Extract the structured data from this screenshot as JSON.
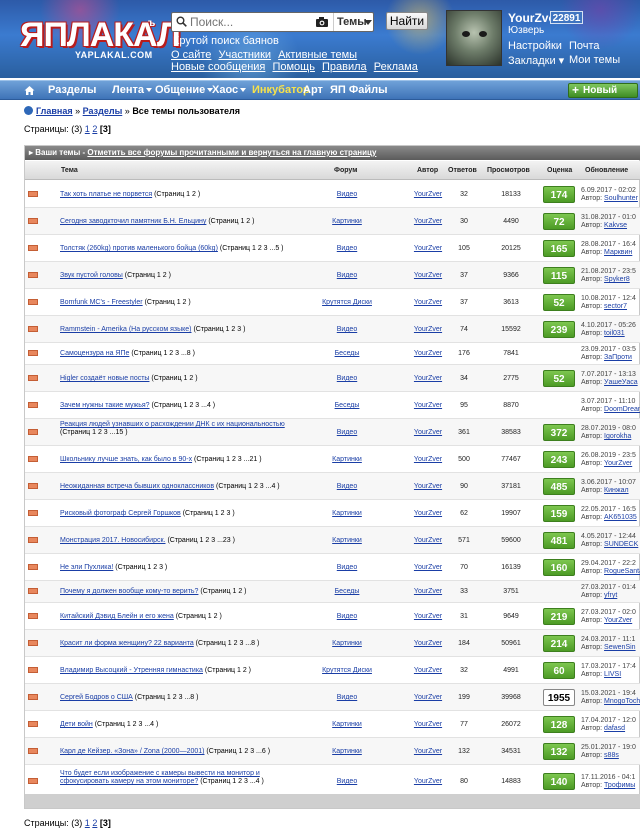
{
  "header": {
    "logo_text": "ЯПЛАКАЛ",
    "logo_sup": "ъ",
    "logo_sub": "YAPLAKAL.COM",
    "search_placeholder": "Поиск...",
    "themes_label": "Темы",
    "find_label": "Найти",
    "tagline": "Крутой поиск баянов",
    "links_row1": [
      "О сайте",
      "Участники",
      "Активные темы"
    ],
    "links_row2": [
      "Новые сообщения",
      "Помощь",
      "Правила",
      "Реклама"
    ],
    "user": {
      "name": "YourZver",
      "rating": "22891",
      "rank": "Юзверь",
      "settings": "Настройки",
      "mail": "Почта",
      "bookmarks": "Закладки",
      "my_topics": "Мои темы"
    }
  },
  "nav": {
    "items": [
      "Разделы",
      "Лента",
      "Общение",
      "Хаос",
      "Инкубатор",
      "Арт",
      "ЯП Файлы"
    ],
    "new_post": "Новый пост"
  },
  "breadcrumb": {
    "home": "Главная",
    "sep1": "»",
    "sections": "Разделы",
    "sep2": "»",
    "current": "Все темы пользователя"
  },
  "pager": {
    "label": "Страницы:",
    "count": "(3)",
    "p1": "1",
    "p2": "2",
    "current": "[3]"
  },
  "topics": {
    "head_label": "Ваши темы",
    "head_dash": " - ",
    "head_link": "Отметить все форумы прочитанными и вернуться на главную страницу",
    "columns": {
      "topic": "Тема",
      "forum": "Форум",
      "author": "Автор",
      "replies": "Ответов",
      "views": "Просмотров",
      "rating": "Оценка",
      "update": "Обновление"
    },
    "rows": [
      {
        "title": "Так хоть платье не порвется",
        "pages": " (Страниц 1 2 )",
        "forum": "Видео",
        "author": "YourZver",
        "replies": "32",
        "views": "18133",
        "rating": "174",
        "rtype": "pos",
        "date": "6.09.2017 - 02:02",
        "last_label": "Автор:",
        "last_author": "Soulhunter"
      },
      {
        "title": "Сегодня заводкточил памятник Б.Н. Ельцину",
        "pages": " (Страниц 1 2 )",
        "forum": "Картинки",
        "author": "YourZver",
        "replies": "30",
        "views": "4490",
        "rating": "72",
        "rtype": "pos",
        "date": "31.08.2017 - 01:0",
        "last_label": "Автор:",
        "last_author": "Kakvse"
      },
      {
        "title": "Толстяк (260kg) против маленького бойца (60kg)",
        "pages": " (Страниц 1 2 3 ...5 )",
        "forum": "Видео",
        "author": "YourZver",
        "replies": "105",
        "views": "20125",
        "rating": "165",
        "rtype": "pos",
        "date": "28.08.2017 - 16:4",
        "last_label": "Автор:",
        "last_author": "Марквин"
      },
      {
        "title": "Звук пустой головы",
        "pages": " (Страниц 1 2 )",
        "forum": "Видео",
        "author": "YourZver",
        "replies": "37",
        "views": "9366",
        "rating": "115",
        "rtype": "pos",
        "date": "21.08.2017 - 23:5",
        "last_label": "Автор:",
        "last_author": "Spyker8"
      },
      {
        "title": "Bomfunk MC's - Freestyler",
        "pages": " (Страниц 1 2 )",
        "forum": "Крутятся Диски",
        "author": "YourZver",
        "replies": "37",
        "views": "3613",
        "rating": "52",
        "rtype": "pos",
        "date": "10.08.2017 - 12:4",
        "last_label": "Автор:",
        "last_author": "sector7"
      },
      {
        "title": "Rammstein - Amerika (На русском языке)",
        "pages": " (Страниц 1 2 3 )",
        "forum": "Видео",
        "author": "YourZver",
        "replies": "74",
        "views": "15592",
        "rating": "239",
        "rtype": "pos",
        "date": "4.10.2017 - 05:26",
        "last_label": "Автор:",
        "last_author": "toil031"
      },
      {
        "title": "Самоцензура на ЯПе",
        "pages": " (Страниц 1 2 3 ...8 )",
        "forum": "Беседы",
        "author": "YourZver",
        "replies": "176",
        "views": "7841",
        "rating": "",
        "rtype": "empty",
        "date": "23.09.2017 - 03:5",
        "last_label": "Автор:",
        "last_author": "ЗаПроти"
      },
      {
        "title": "Higler создаёт новые посты",
        "pages": " (Страниц 1 2 )",
        "forum": "Видео",
        "author": "YourZver",
        "replies": "34",
        "views": "2775",
        "rating": "52",
        "rtype": "pos",
        "date": "7.07.2017 - 13:13",
        "last_label": "Автор:",
        "last_author": "УашеУаса"
      },
      {
        "title": "Зачем нужны такие мужья?",
        "pages": " (Страниц 1 2 3 ...4 )",
        "forum": "Беседы",
        "author": "YourZver",
        "replies": "95",
        "views": "8870",
        "rating": "",
        "rtype": "empty",
        "date": "3.07.2017 - 11:10",
        "last_label": "Автор:",
        "last_author": "DoomDreams"
      },
      {
        "title": "Реакция людей узнавших о расхождении ДНК с их национальностью",
        "pages": " (Страниц 1 2 3 ...15 )",
        "forum": "Видео",
        "author": "YourZver",
        "replies": "361",
        "views": "38583",
        "rating": "372",
        "rtype": "pos",
        "date": "28.07.2019 - 08:0",
        "last_label": "Автор:",
        "last_author": "Igorokha"
      },
      {
        "title": "Школьнику лучше знать, как было в 90-х",
        "pages": " (Страниц 1 2 3 ...21 )",
        "forum": "Картинки",
        "author": "YourZver",
        "replies": "500",
        "views": "77467",
        "rating": "243",
        "rtype": "pos",
        "date": "26.08.2019 - 23:5",
        "last_label": "Автор:",
        "last_author": "YourZver"
      },
      {
        "title": "Неожиданная встреча бывших одноклассников",
        "pages": " (Страниц 1 2 3 ...4 )",
        "forum": "Видео",
        "author": "YourZver",
        "replies": "90",
        "views": "37181",
        "rating": "485",
        "rtype": "pos",
        "date": "3.06.2017 - 10:07",
        "last_label": "Автор:",
        "last_author": "Кинжал"
      },
      {
        "title": "Рисковый фотограф Сергей Горшков",
        "pages": " (Страниц 1 2 3 )",
        "forum": "Картинки",
        "author": "YourZver",
        "replies": "62",
        "views": "19907",
        "rating": "159",
        "rtype": "pos",
        "date": "22.05.2017 - 16:5",
        "last_label": "Автор:",
        "last_author": "AK651035"
      },
      {
        "title": "Монстрация 2017. Новосибирск.",
        "pages": " (Страниц 1 2 3 ...23 )",
        "forum": "Картинки",
        "author": "YourZver",
        "replies": "571",
        "views": "59600",
        "rating": "481",
        "rtype": "pos",
        "date": "4.05.2017 - 12:44",
        "last_label": "Автор:",
        "last_author": "SUNDECK"
      },
      {
        "title": "Не эли Пухлика!",
        "pages": " (Страниц 1 2 3 )",
        "forum": "Видео",
        "author": "YourZver",
        "replies": "70",
        "views": "16139",
        "rating": "160",
        "rtype": "pos",
        "date": "29.04.2017 - 22:2",
        "last_label": "Автор:",
        "last_author": "RogueSantaCruz"
      },
      {
        "title": "Почему я должен вообще кому-то верить?",
        "pages": " (Страниц 1 2 )",
        "forum": "Беседы",
        "author": "YourZver",
        "replies": "33",
        "views": "3751",
        "rating": "",
        "rtype": "empty",
        "date": "27.03.2017 - 01:4",
        "last_label": "Автор:",
        "last_author": "yfryt"
      },
      {
        "title": "Китайский Дэвид Блейн и его жена",
        "pages": " (Страниц 1 2 )",
        "forum": "Видео",
        "author": "YourZver",
        "replies": "31",
        "views": "9649",
        "rating": "219",
        "rtype": "pos",
        "date": "27.03.2017 - 02:0",
        "last_label": "Автор:",
        "last_author": "YourZver"
      },
      {
        "title": "Красит ли форма женщину? 22 варианта",
        "pages": " (Страниц 1 2 3 ...8 )",
        "forum": "Картинки",
        "author": "YourZver",
        "replies": "184",
        "views": "50961",
        "rating": "214",
        "rtype": "pos",
        "date": "24.03.2017 - 11:1",
        "last_label": "Автор:",
        "last_author": "SewenSin"
      },
      {
        "title": "Владимир Высоцкий - Утренняя гимнастика",
        "pages": " (Страниц 1 2 )",
        "forum": "Крутятся Диски",
        "author": "YourZver",
        "replies": "32",
        "views": "4991",
        "rating": "60",
        "rtype": "pos",
        "date": "17.03.2017 - 17:4",
        "last_label": "Автор:",
        "last_author": "LIVSI"
      },
      {
        "title": "Сергей Бодров о США",
        "pages": " (Страниц 1 2 3 ...8 )",
        "forum": "Видео",
        "author": "YourZver",
        "replies": "199",
        "views": "39968",
        "rating": "1955",
        "rtype": "neutral",
        "date": "15.03.2021 - 19:4",
        "last_label": "Автор:",
        "last_author": "MnogoTochie"
      },
      {
        "title": "Дети войн",
        "pages": " (Страниц 1 2 3 ...4 )",
        "forum": "Картинки",
        "author": "YourZver",
        "replies": "77",
        "views": "26072",
        "rating": "128",
        "rtype": "pos",
        "date": "17.04.2017 - 12:0",
        "last_label": "Автор:",
        "last_author": "dafasd"
      },
      {
        "title": "Карл де Кейзер. «Зона» / Zona (2000—2001)",
        "pages": " (Страниц 1 2 3 ...6 )",
        "forum": "Картинки",
        "author": "YourZver",
        "replies": "132",
        "views": "34531",
        "rating": "132",
        "rtype": "pos",
        "date": "25.01.2017 - 19:0",
        "last_label": "Автор:",
        "last_author": "s88s"
      },
      {
        "title": "Что будет если изображение с камеры вывести на монитор и сфокусировать камеру на этом мониторе?",
        "pages": " (Страниц 1 2 3 ...4 )",
        "forum": "Видео",
        "author": "YourZver",
        "replies": "80",
        "views": "14883",
        "rating": "140",
        "rtype": "pos",
        "date": "17.11.2016 - 04:1",
        "last_label": "Автор:",
        "last_author": "Трофимы"
      }
    ]
  }
}
